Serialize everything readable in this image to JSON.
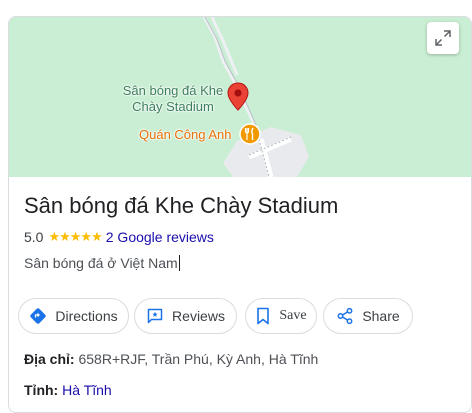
{
  "map": {
    "place_label": "Sân bóng đá Khe Chày Stadium",
    "restaurant_label": "Quán Công Anh",
    "colors": {
      "land": "#c9eed3",
      "road": "#ffffff",
      "pin": "#ea4335",
      "restaurant": "#e8710a"
    }
  },
  "place": {
    "title": "Sân bóng đá Khe Chày Stadium",
    "rating": "5.0",
    "stars": "★★★★★",
    "reviews_link": "2 Google reviews",
    "category": "Sân bóng đá ở Việt Nam"
  },
  "actions": {
    "directions": "Directions",
    "reviews": "Reviews",
    "save": "Save",
    "share": "Share"
  },
  "details": {
    "address_label": "Địa chỉ:",
    "address_value": "658R+RJF, Trần Phú, Kỳ Anh, Hà Tĩnh",
    "province_label": "Tỉnh:",
    "province_value": "Hà Tĩnh"
  }
}
